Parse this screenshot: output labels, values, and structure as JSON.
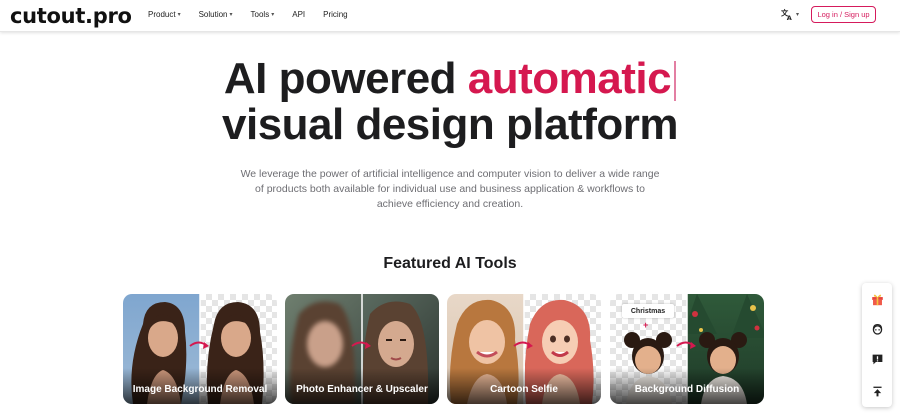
{
  "header": {
    "logo": "cutout.pro",
    "nav": [
      {
        "label": "Product",
        "dropdown": true
      },
      {
        "label": "Solution",
        "dropdown": true
      },
      {
        "label": "Tools",
        "dropdown": true
      },
      {
        "label": "API",
        "dropdown": false
      },
      {
        "label": "Pricing",
        "dropdown": false
      }
    ],
    "language_icon": "translate-icon",
    "login_label": "Log in / Sign up"
  },
  "hero": {
    "title_part1": "AI powered ",
    "title_highlight": "automatic",
    "title_line2": "visual design platform",
    "description": "We leverage the power of artificial intelligence and computer vision to deliver a wide range of products both available for individual use and business application & workflows to achieve efficiency and creation."
  },
  "featured": {
    "title": "Featured AI Tools",
    "cards": [
      {
        "label": "Image Background Removal"
      },
      {
        "label": "Photo Enhancer & Upscaler"
      },
      {
        "label": "Cartoon Selfie"
      },
      {
        "label": "Background Diffusion",
        "tag": "Christmas",
        "plus": "+"
      }
    ]
  },
  "sidebar": {
    "icons": [
      "gift-icon",
      "support-agent-icon",
      "feedback-icon",
      "back-to-top-icon"
    ]
  },
  "colors": {
    "accent": "#d5184f",
    "text": "#1d1d1f",
    "muted": "#6e6e73"
  }
}
